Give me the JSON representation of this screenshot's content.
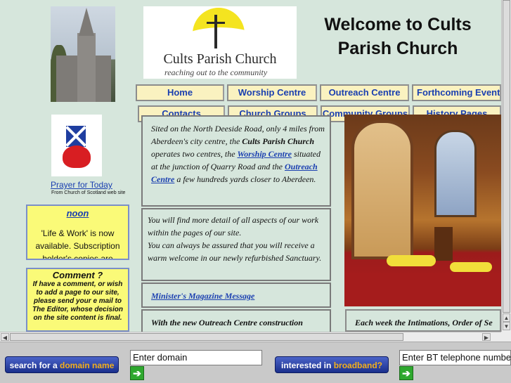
{
  "header": {
    "logo_name": "Cults Parish Church",
    "logo_tagline": "reaching out to the community",
    "welcome_line1": "Welcome to Cults",
    "welcome_line2": "Parish Church"
  },
  "nav": {
    "home": "Home",
    "worship": "Worship Centre",
    "outreach": "Outreach Centre",
    "forthcoming": "Forthcoming Events",
    "contacts": "Contacts",
    "groups": "Church Groups",
    "community": "Community Groups",
    "history": "History Pages"
  },
  "sidebar": {
    "prayer_link": "Prayer for Today",
    "prayer_source": "From Church of Scotland web site",
    "noon_title": "noon",
    "noon_text": "'Life & Work' is now available. Subscription holder's copies are",
    "comment_title": "Comment ?",
    "comment_text": "If have a comment, or wish to add a page to our site, please send your e mail to The Editor, whose decision on the site content is final."
  },
  "main": {
    "intro_pre": "Sited on the North Deeside Road, only 4 miles from Aberdeen's city centre, the",
    "intro_church": "Cults Parish Church",
    "intro_mid": "operates two centres, the",
    "intro_worship_link": "Worship Centre",
    "intro_mid2": "situated at the junction of Quarry Road and the",
    "intro_outreach_link": "Outreach Centre",
    "intro_end": "a few hundreds yards closer to Aberdeen.",
    "detail_text": "You will find more detail of all aspects of our work within the pages of our site.",
    "welcome_text": "You can always be assured that you will receive a warm welcome in our newly refurbished Sanctuary.",
    "magazine_link": "Minister's Magazine Message",
    "outreach_text": "With the new Outreach Centre construction complete, the community date of its",
    "intimations_text": "Each week the Intimations, Order of Se"
  },
  "ads": {
    "domain_btn_pre": "search for a",
    "domain_btn_hl": "domain name",
    "domain_input": "Enter domain",
    "broadband_btn_pre": "interested in",
    "broadband_btn_hl": "broadband?",
    "phone_input": "Enter BT telephone number",
    "go_arrow": "➔"
  }
}
